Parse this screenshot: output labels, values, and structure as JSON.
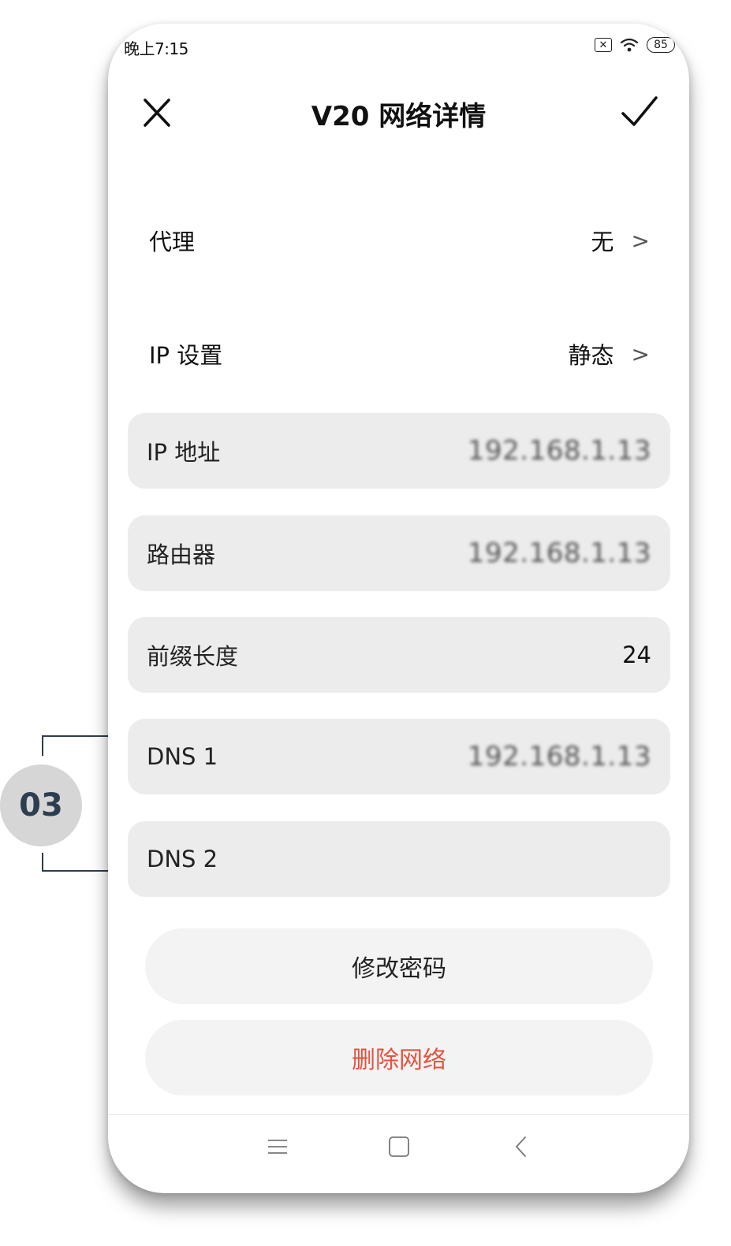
{
  "status_bar": {
    "time": "晚上7:15",
    "sim_icon": "sim-disabled-icon",
    "wifi_icon": "wifi-icon",
    "battery": "85"
  },
  "header": {
    "title": "V20 网络详情",
    "close_icon": "close-icon",
    "confirm_icon": "checkmark-icon"
  },
  "settings": {
    "proxy": {
      "label": "代理",
      "value": "无"
    },
    "ip_settings": {
      "label": "IP 设置",
      "value": "静态"
    }
  },
  "fields": {
    "ip_address": {
      "label": "IP 地址",
      "value": "192.168.1.13"
    },
    "router": {
      "label": "路由器",
      "value": "192.168.1.13"
    },
    "prefix_length": {
      "label": "前缀长度",
      "value": "24"
    },
    "dns1": {
      "label": "DNS 1",
      "value": "192.168.1.13"
    },
    "dns2": {
      "label": "DNS 2",
      "value": ""
    }
  },
  "actions": {
    "change_password": "修改密码",
    "delete_network": "删除网络"
  },
  "annotation": {
    "badge": "03"
  },
  "colors": {
    "delete": "#e2533f",
    "field_bg": "#ececec",
    "annotation": "#2d3e4f"
  }
}
